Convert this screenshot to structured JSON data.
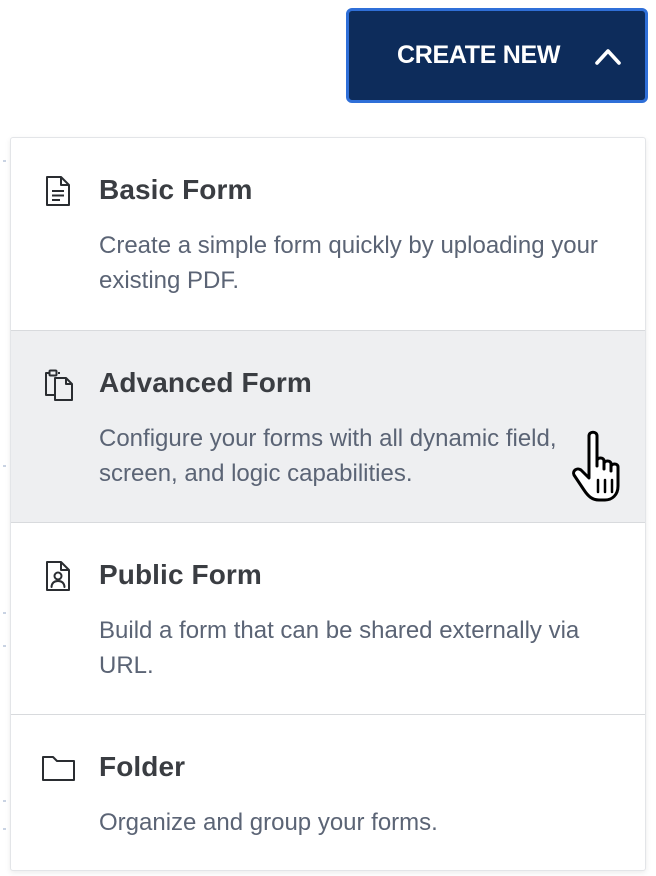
{
  "create_new": {
    "label": "CREATE NEW",
    "chevron_icon": "chevron-up-icon",
    "colors": {
      "background": "#0d2c5b",
      "border": "#2f6fd8",
      "text": "#ffffff"
    }
  },
  "menu": {
    "hovered_item": "advanced-form",
    "hover_color": "#eeeff1",
    "items": [
      {
        "id": "basic-form",
        "icon": "document-icon",
        "title": "Basic Form",
        "description": "Create a simple form quickly by uploading your existing PDF."
      },
      {
        "id": "advanced-form",
        "icon": "clipboard-copy-icon",
        "title": "Advanced Form",
        "description": "Configure your forms with all dynamic field, screen, and logic capabilities."
      },
      {
        "id": "public-form",
        "icon": "document-person-icon",
        "title": "Public Form",
        "description": "Build a form that can be shared externally via URL."
      },
      {
        "id": "folder",
        "icon": "folder-icon",
        "title": "Folder",
        "description": "Organize and group your forms."
      }
    ]
  },
  "cursor": {
    "icon": "hand-pointer-icon"
  }
}
